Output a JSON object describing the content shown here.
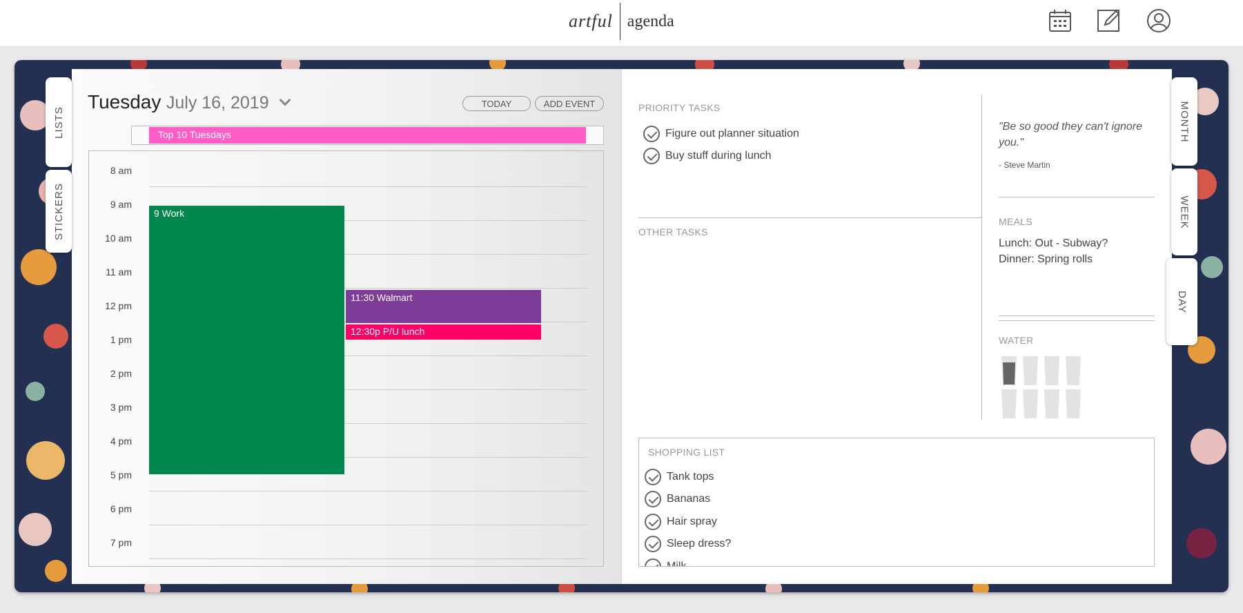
{
  "app": {
    "logo_left": "artful",
    "logo_right": "agenda"
  },
  "top_icons": [
    "calendar-icon",
    "edit-icon",
    "account-icon"
  ],
  "side_tabs_left": [
    "LISTS",
    "STICKERS"
  ],
  "side_tabs_right": [
    "MONTH",
    "WEEK",
    "DAY"
  ],
  "header": {
    "weekday": "Tuesday",
    "date": "July 16, 2019",
    "today_label": "TODAY",
    "add_event_label": "ADD EVENT"
  },
  "all_day_event": {
    "title": "Top 10 Tuesdays",
    "color": "#ff5cc8"
  },
  "hours": [
    "8 am",
    "9 am",
    "10 am",
    "11 am",
    "12 pm",
    "1 pm",
    "2 pm",
    "3 pm",
    "4 pm",
    "5 pm",
    "6 pm",
    "7 pm"
  ],
  "events": [
    {
      "title": "9 Work",
      "color": "#00874e"
    },
    {
      "title": "11:30 Walmart",
      "color": "#7d3c98"
    },
    {
      "title": "12:30p P/U lunch",
      "color": "#ff0066"
    }
  ],
  "priority": {
    "title": "PRIORITY TASKS",
    "items": [
      "Figure out planner situation",
      "Buy stuff during lunch"
    ]
  },
  "other": {
    "title": "OTHER TASKS"
  },
  "quote": {
    "text": "\"Be so good they can't ignore you.\"",
    "author": "- Steve Martin"
  },
  "meals": {
    "title": "MEALS",
    "lunch": "Lunch: Out - Subway?",
    "dinner": "Dinner: Spring rolls"
  },
  "water": {
    "title": "WATER",
    "glasses_total": 8,
    "glasses_filled": 1
  },
  "shopping": {
    "title": "SHOPPING LIST",
    "items": [
      "Tank tops",
      "Bananas",
      "Hair spray",
      "Sleep dress?",
      "Milk"
    ]
  }
}
